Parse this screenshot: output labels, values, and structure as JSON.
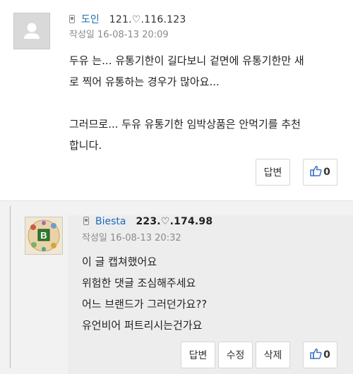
{
  "comment1": {
    "author": "도인",
    "ip": "121.♡.116.123",
    "date": "작성일   16-08-13 20:09",
    "lines": [
      "두유 는... 유통기한이 길다보니 겉면에 유통기한만 새",
      "로 찍어 유통하는 경우가 많아요...",
      "",
      "그러므로... 두유 유통기한 임박상품은 안먹기를 추천",
      "합니다."
    ],
    "reply_label": "답변",
    "likes": "0"
  },
  "comment2": {
    "author": "Biesta",
    "ip": "223.♡.174.98",
    "date": "작성일   16-08-13 20:32",
    "lines": [
      "이 글 캡쳐했어요",
      "위험한 댓글 조심해주세요",
      "어느 브랜드가 그러던가요??",
      "유언비어 퍼트리시는건가요"
    ],
    "reply_label": "답변",
    "edit_label": "수정",
    "delete_label": "삭제",
    "likes": "0",
    "avatar_letter": "B"
  }
}
